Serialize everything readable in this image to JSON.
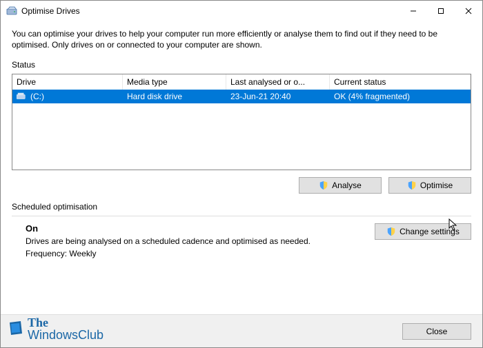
{
  "window": {
    "title": "Optimise Drives"
  },
  "intro": "You can optimise your drives to help your computer run more efficiently or analyse them to find out if they need to be optimised. Only drives on or connected to your computer are shown.",
  "status_label": "Status",
  "columns": {
    "drive": "Drive",
    "media": "Media type",
    "last": "Last analysed or o...",
    "status": "Current status"
  },
  "rows": [
    {
      "drive": "(C:)",
      "media": "Hard disk drive",
      "last": "23-Jun-21 20:40",
      "status": "OK (4% fragmented)"
    }
  ],
  "buttons": {
    "analyse": "Analyse",
    "optimise": "Optimise",
    "change_settings": "Change settings",
    "close": "Close"
  },
  "scheduled": {
    "label": "Scheduled optimisation",
    "state": "On",
    "desc": "Drives are being analysed on a scheduled cadence and optimised as needed.",
    "frequency": "Frequency: Weekly"
  },
  "watermark": {
    "line1": "The",
    "line2": "WindowsClub"
  }
}
